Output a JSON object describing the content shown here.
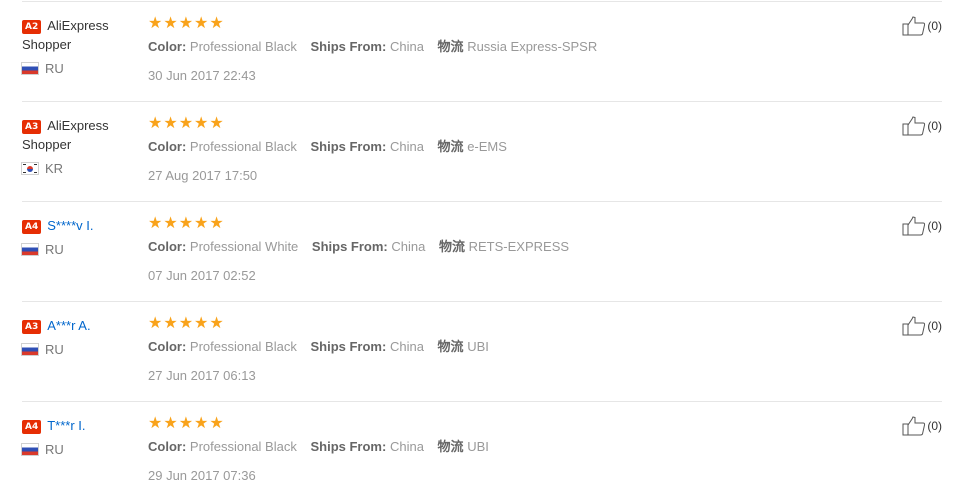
{
  "reviews": [
    {
      "level": "A2",
      "name": "AliExpress Shopper",
      "name_is_link": false,
      "country_code": "RU",
      "flag_icon": "russia-flag-icon",
      "rating": 5,
      "stars": [
        "★",
        "★",
        "★",
        "★",
        "★"
      ],
      "color_label": "Color:",
      "color_value": "Professional Black",
      "ships_label": "Ships From:",
      "ships_value": "China",
      "logistics_label": "物流",
      "logistics_value": "Russia Express-SPSR",
      "date": "30 Jun 2017 22:43",
      "helpful_count": "(0)"
    },
    {
      "level": "A3",
      "name": "AliExpress Shopper",
      "name_is_link": false,
      "country_code": "KR",
      "flag_icon": "south-korea-flag-icon",
      "rating": 5,
      "stars": [
        "★",
        "★",
        "★",
        "★",
        "★"
      ],
      "color_label": "Color:",
      "color_value": "Professional Black",
      "ships_label": "Ships From:",
      "ships_value": "China",
      "logistics_label": "物流",
      "logistics_value": "e-EMS",
      "date": "27 Aug 2017 17:50",
      "helpful_count": "(0)"
    },
    {
      "level": "A4",
      "name": "S****v I.",
      "name_is_link": true,
      "country_code": "RU",
      "flag_icon": "russia-flag-icon",
      "rating": 5,
      "stars": [
        "★",
        "★",
        "★",
        "★",
        "★"
      ],
      "color_label": "Color:",
      "color_value": "Professional White",
      "ships_label": "Ships From:",
      "ships_value": "China",
      "logistics_label": "物流",
      "logistics_value": "RETS-EXPRESS",
      "date": "07 Jun 2017 02:52",
      "helpful_count": "(0)"
    },
    {
      "level": "A3",
      "name": "A***r A.",
      "name_is_link": true,
      "country_code": "RU",
      "flag_icon": "russia-flag-icon",
      "rating": 5,
      "stars": [
        "★",
        "★",
        "★",
        "★",
        "★"
      ],
      "color_label": "Color:",
      "color_value": "Professional Black",
      "ships_label": "Ships From:",
      "ships_value": "China",
      "logistics_label": "物流",
      "logistics_value": "UBI",
      "date": "27 Jun 2017 06:13",
      "helpful_count": "(0)"
    },
    {
      "level": "A4",
      "name": "T***r I.",
      "name_is_link": true,
      "country_code": "RU",
      "flag_icon": "russia-flag-icon",
      "rating": 5,
      "stars": [
        "★",
        "★",
        "★",
        "★",
        "★"
      ],
      "color_label": "Color:",
      "color_value": "Professional Black",
      "ships_label": "Ships From:",
      "ships_value": "China",
      "logistics_label": "物流",
      "logistics_value": "UBI",
      "date": "29 Jun 2017 07:36",
      "helpful_count": "(0)"
    }
  ],
  "colors": {
    "level_badge": "#e62e04",
    "star": "#f9a31b",
    "buyer_link": "#0066cc",
    "divider": "#e6e6e6"
  },
  "icons": {
    "helpful": "thumbs-up-icon",
    "star": "star-icon"
  }
}
